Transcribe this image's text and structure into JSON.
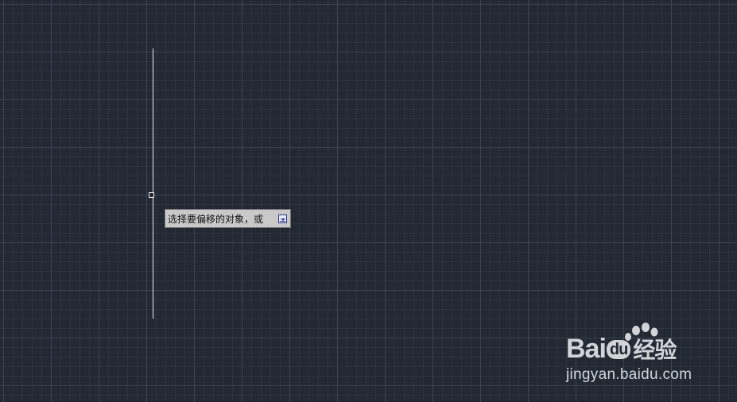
{
  "drawing": {
    "background_color": "#222933",
    "grid_minor_color": "#343c48",
    "grid_major_color": "#46505f",
    "entity_color": "#e8ecf0"
  },
  "tooltip": {
    "prompt": "选择要偏移的对象，或",
    "expand_icon": "expand-options-icon"
  },
  "watermark": {
    "brand_prefix": "Bai",
    "brand_du": "du",
    "brand_cn": "经验",
    "url": "jingyan.baidu.com",
    "icon": "paw-icon"
  }
}
